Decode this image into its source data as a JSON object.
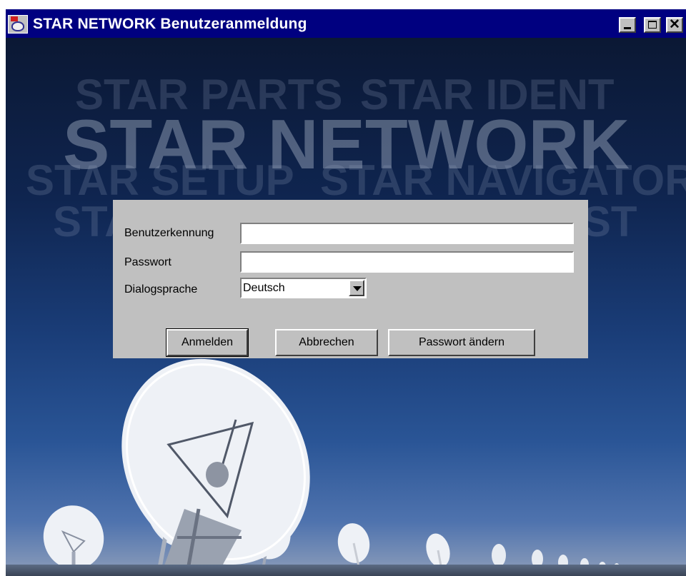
{
  "window": {
    "title": "STAR NETWORK Benutzeranmeldung",
    "controls": {
      "minimize": "minimize-icon",
      "maximize": "maximize-icon",
      "close": "close-icon",
      "close_glyph": "✕"
    },
    "app_icon": "satellite-dish-icon"
  },
  "backdrop": {
    "words": {
      "parts": "STAR PARTS",
      "ident": "STAR IDENT",
      "network": "STAR NETWORK",
      "setup": "STAR SETUP",
      "navigator": "STAR NAVIGATOR",
      "feedback": "STAR FEEDBACK",
      "list": "STAR LIST"
    }
  },
  "login": {
    "user_label": "Benutzerkennung",
    "user_value": "",
    "password_label": "Passwort",
    "password_value": "",
    "language_label": "Dialogsprache",
    "language_value": "Deutsch",
    "buttons": {
      "login": "Anmelden",
      "cancel": "Abbrechen",
      "change_password": "Passwort ändern"
    }
  },
  "colors": {
    "titlebar": "#000080",
    "panel": "#c0c0c0",
    "sky_top": "#0b1834",
    "sky_bottom": "#8e9eba"
  }
}
